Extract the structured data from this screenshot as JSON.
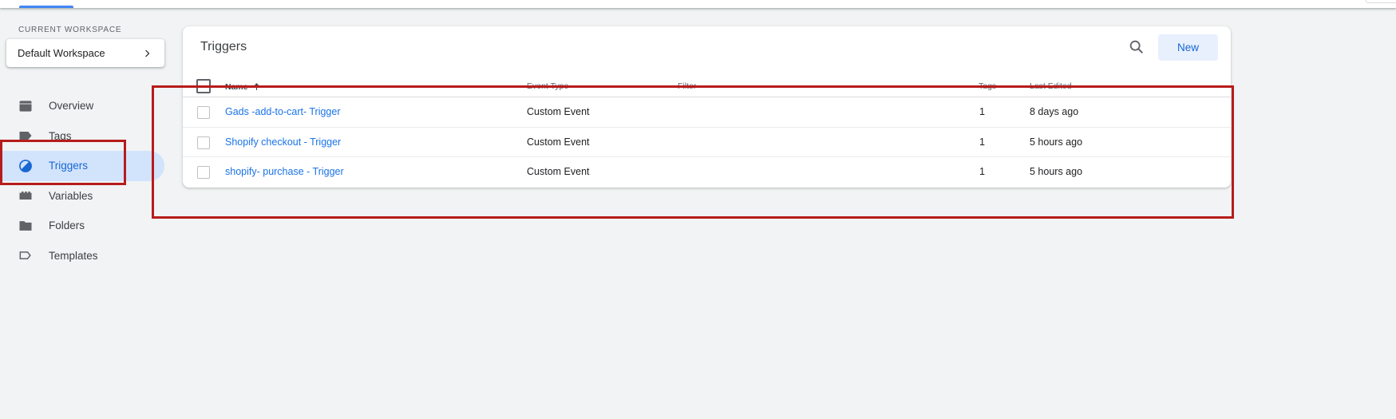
{
  "sidebar": {
    "workspace_label": "CURRENT WORKSPACE",
    "workspace_name": "Default Workspace",
    "items": [
      {
        "label": "Overview",
        "icon": "overview-icon"
      },
      {
        "label": "Tags",
        "icon": "tag-icon"
      },
      {
        "label": "Triggers",
        "icon": "trigger-icon"
      },
      {
        "label": "Variables",
        "icon": "variables-icon"
      },
      {
        "label": "Folders",
        "icon": "folder-icon"
      },
      {
        "label": "Templates",
        "icon": "template-icon"
      }
    ],
    "active_item": "Triggers"
  },
  "main": {
    "title": "Triggers",
    "new_label": "New",
    "columns": {
      "name": "Name",
      "event_type": "Event Type",
      "filter": "Filter",
      "tags": "Tags",
      "last_edited": "Last Edited"
    },
    "sort_icon": "arrow-up-icon",
    "rows": [
      {
        "name": "Gads -add-to-cart- Trigger",
        "event_type": "Custom Event",
        "filter": "",
        "tags": "1",
        "last_edited": "8 days ago"
      },
      {
        "name": "Shopify checkout - Trigger",
        "event_type": "Custom Event",
        "filter": "",
        "tags": "1",
        "last_edited": "5 hours ago"
      },
      {
        "name": "shopify- purchase - Trigger",
        "event_type": "Custom Event",
        "filter": "",
        "tags": "1",
        "last_edited": "5 hours ago"
      }
    ]
  },
  "colors": {
    "accent": "#1967d2",
    "active_bg": "#d2e3fc",
    "link": "#1a73e8",
    "annotation": "#b71c1c",
    "background": "#f1f3f4"
  }
}
